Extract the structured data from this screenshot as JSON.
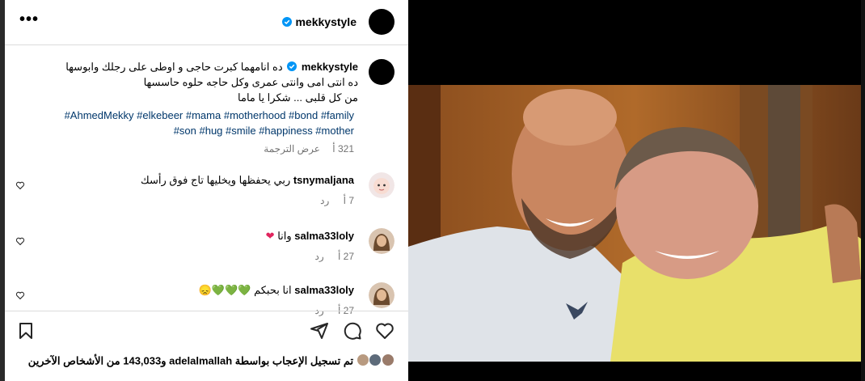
{
  "header": {
    "more_label": "•••",
    "username": "mekkystyle"
  },
  "caption": {
    "username": "mekkystyle",
    "line1": "ده انامهما كبرت حاجى و اوطى على رجلك وابوسها",
    "line2": "ده انتى امى وانتى عمرى وكل حاجه حلوه حاسسها",
    "line3": "من كل قلبى ... شكرا يا ماما",
    "hashtags_line1": "#AhmedMekky #elkebeer #mama #motherhood #bond #family",
    "hashtags_line2": "#son #hug #smile #happiness #mother",
    "time": "321 أ",
    "translate": "عرض الترجمة"
  },
  "comments": [
    {
      "username": "tsnymaljana",
      "text": "ربي يحفظها ويخليها تاج فوق رأسك",
      "time": "7 أ",
      "reply": "رد"
    },
    {
      "username": "salma33loly",
      "text": "وانا",
      "emoji": "❤",
      "time": "27 أ",
      "reply": "رد"
    },
    {
      "username": "salma33loly",
      "text": "انا بحبكم",
      "emoji": "💚💚💚😞",
      "time": "27 أ",
      "reply": "رد"
    }
  ],
  "likes": {
    "text": "تم تسجيل الإعجاب بواسطة adelalmallah و143,033 من الأشخاص الآخرين"
  },
  "colors": {
    "accent_verified": "#0095f6",
    "hashtag": "#00376b",
    "muted": "#737373",
    "divider": "#dbdbdb"
  }
}
